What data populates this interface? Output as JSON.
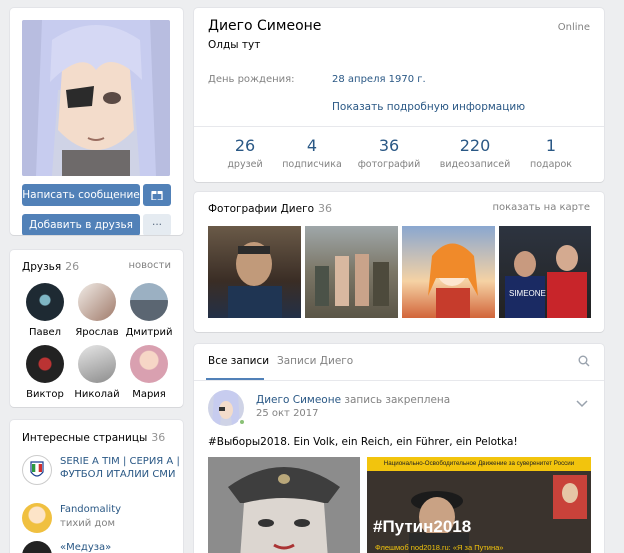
{
  "profile": {
    "name": "Диего Симеоне",
    "status": "Олды тут",
    "online": "Online",
    "birthday_label": "День рождения:",
    "birthday_value": "28 апреля 1970 г.",
    "more_info": "Показать подробную информацию"
  },
  "actions": {
    "message": "Написать сообщение",
    "add_friend": "Добавить в друзья",
    "more": "···"
  },
  "stats": [
    {
      "num": "26",
      "label": "друзей"
    },
    {
      "num": "4",
      "label": "подписчика"
    },
    {
      "num": "36",
      "label": "фотографий"
    },
    {
      "num": "220",
      "label": "видеозаписей"
    },
    {
      "num": "1",
      "label": "подарок"
    }
  ],
  "photos": {
    "title": "Фотографии Диего",
    "count": "36",
    "map_link": "показать на карте"
  },
  "friends": {
    "title": "Друзья",
    "count": "26",
    "news_link": "новости",
    "items": [
      "Павел",
      "Ярослав",
      "Дмитрий",
      "Виктор",
      "Николай",
      "Мария"
    ]
  },
  "pages": {
    "title": "Интересные страницы",
    "count": "36",
    "items": [
      {
        "name": "SERIE A TIM | СЕРИЯ А | ФУТБОЛ ИТАЛИИ СМИ",
        "sub": ""
      },
      {
        "name": "Fandomality",
        "sub": "тихий дом"
      },
      {
        "name": "«Медуза»",
        "sub": ""
      }
    ]
  },
  "wall": {
    "tab_all": "Все записи",
    "tab_own": "Записи Диего",
    "post_author": "Диего Симеоне",
    "post_pinned": "запись закреплена",
    "post_date": "25 окт 2017",
    "post_text": "#Выборы2018. Ein Volk, ein Reich, ein Führer, ein Pelotka!",
    "poster_header": "Национально-Освободительное Движение за суверенитет России",
    "poster_hashtag": "#Путин2018",
    "poster_footer": "Флешмоб nod2018.ru: «Я за Путина»"
  },
  "colors": {
    "accent": "#5181b8",
    "link": "#2a5885",
    "bg": "#edeef0"
  }
}
